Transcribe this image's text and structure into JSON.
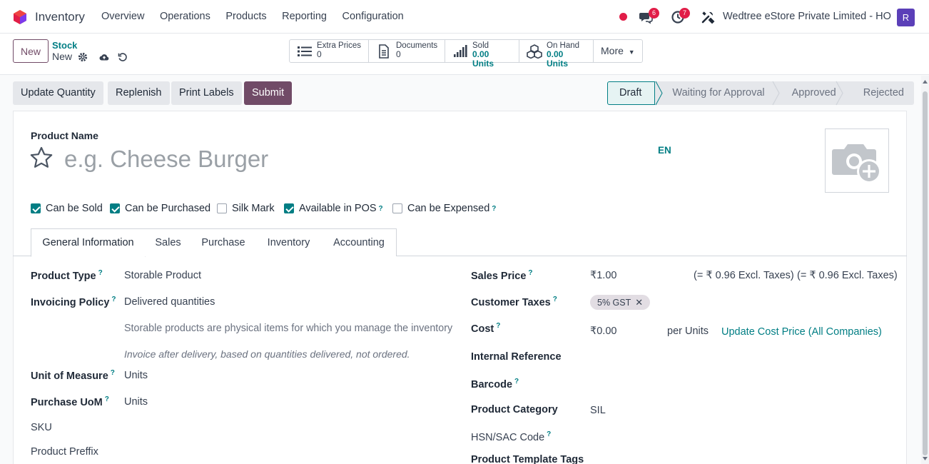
{
  "nav": {
    "app_name": "Inventory",
    "menu": [
      "Overview",
      "Operations",
      "Products",
      "Reporting",
      "Configuration"
    ],
    "messages_count": "6",
    "activities_count": "7",
    "company": "Wedtree eStore Private Limited - HO",
    "avatar_initial": "R"
  },
  "control": {
    "new_label": "New",
    "breadcrumb_parent": "Stock",
    "breadcrumb_current": "New",
    "smart_buttons": [
      {
        "label": "Extra Prices",
        "value": "0",
        "icon": "list-icon"
      },
      {
        "label": "Documents",
        "value": "0",
        "icon": "document-icon"
      },
      {
        "label": "Sold",
        "value": "0.00 Units",
        "icon": "bar-chart-icon"
      },
      {
        "label": "On Hand",
        "value": "0.00 Units",
        "icon": "cubes-icon"
      }
    ],
    "more_label": "More"
  },
  "actions": {
    "update_quantity": "Update Quantity",
    "replenish": "Replenish",
    "print_labels": "Print Labels",
    "submit": "Submit"
  },
  "status": [
    "Draft",
    "Waiting for Approval",
    "Approved",
    "Rejected"
  ],
  "form": {
    "product_name_label": "Product Name",
    "product_name_placeholder": "e.g. Cheese Burger",
    "lang": "EN",
    "checkboxes": [
      {
        "label": "Can be Sold",
        "checked": true
      },
      {
        "label": "Can be Purchased",
        "checked": true
      },
      {
        "label": "Silk Mark",
        "checked": false
      },
      {
        "label": "Available in POS",
        "checked": true
      },
      {
        "label": "Can be Expensed",
        "checked": false
      }
    ],
    "help_mark": "?",
    "tabs": [
      "General Information",
      "Sales",
      "Purchase",
      "Inventory",
      "Accounting"
    ],
    "left": {
      "product_type_label": "Product Type",
      "product_type": "Storable Product",
      "invoicing_policy_label": "Invoicing Policy",
      "invoicing_policy": "Delivered quantities",
      "storable_help": "Storable products are physical items for which you manage the inventory",
      "invoice_help": "Invoice after delivery, based on quantities delivered, not ordered.",
      "uom_label": "Unit of Measure",
      "uom": "Units",
      "purchase_uom_label": "Purchase UoM",
      "purchase_uom": "Units",
      "sku_label": "SKU",
      "prefix_label": "Product Preffix"
    },
    "right": {
      "sales_price_label": "Sales Price",
      "sales_price": "₹1.00",
      "excl_taxes_1": "(= ₹ 0.96 Excl. Taxes)",
      "excl_taxes_2": "(= ₹ 0.96 Excl. Taxes)",
      "customer_taxes_label": "Customer Taxes",
      "tax_tag": "5% GST",
      "cost_label": "Cost",
      "cost": "₹0.00",
      "per_units": "per Units",
      "update_cost": "Update Cost Price (All Companies)",
      "internal_ref_label": "Internal Reference",
      "barcode_label": "Barcode",
      "category_label": "Product Category",
      "category": "SIL",
      "hsn_label": "HSN/SAC Code",
      "tags_label": "Product Template Tags"
    }
  }
}
